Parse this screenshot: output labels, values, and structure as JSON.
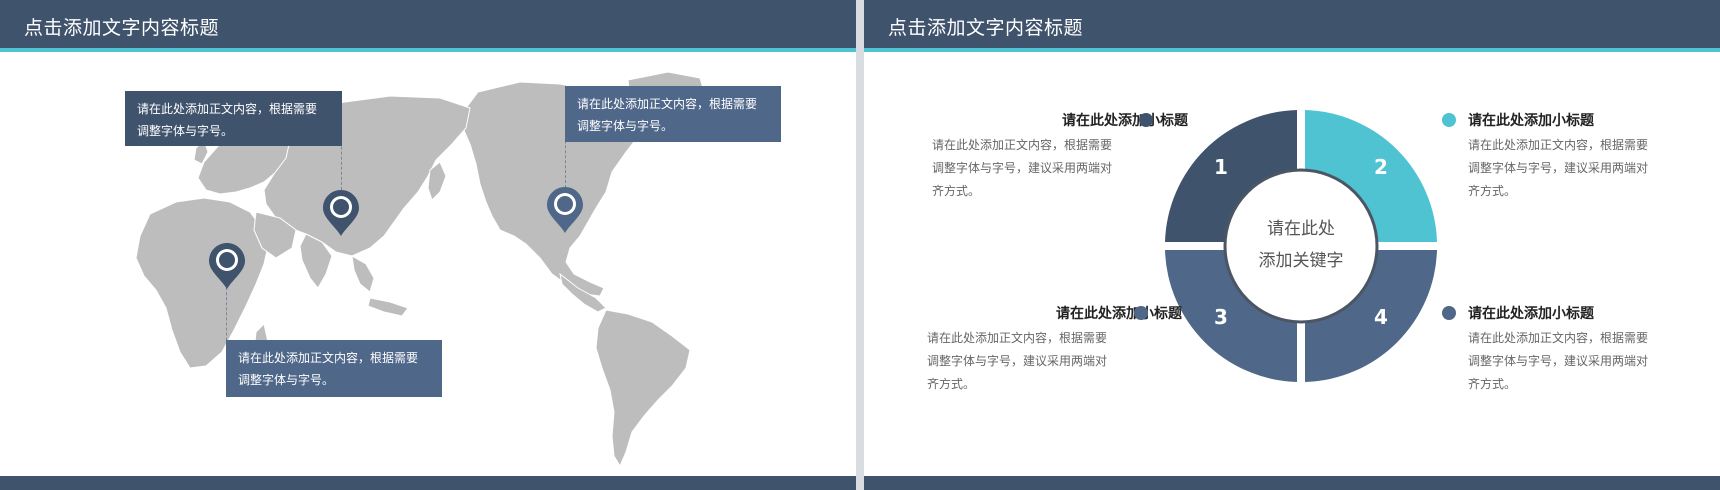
{
  "left_slide": {
    "title": "点击添加文字内容标题",
    "callouts": [
      {
        "text_line1": "请在此处添加正文内容，根据需要",
        "text_line2": "调整字体与字号。"
      },
      {
        "text_line1": "请在此处添加正文内容，根据需要",
        "text_line2": "调整字体与字号。"
      },
      {
        "text_line1": "请在此处添加正文内容，根据需要",
        "text_line2": "调整字体与字号。"
      }
    ],
    "map_pins": [
      "map-pin-icon",
      "map-pin-icon",
      "map-pin-icon"
    ]
  },
  "right_slide": {
    "title": "点击添加文字内容标题",
    "center_line1": "请在此处",
    "center_line2": "添加关键字",
    "segments": [
      "1",
      "2",
      "3",
      "4"
    ],
    "items": [
      {
        "title": "请在此处添加小标题",
        "body_line1": "请在此处添加正文内容，根据需要",
        "body_line2": "调整字体与字号，建议采用两端对",
        "body_line3": "齐方式。"
      },
      {
        "title": "请在此处添加小标题",
        "body_line1": "请在此处添加正文内容，根据需要",
        "body_line2": "调整字体与字号，建议采用两端对",
        "body_line3": "齐方式。"
      },
      {
        "title": "请在此处添加小标题",
        "body_line1": "请在此处添加正文内容，根据需要",
        "body_line2": "调整字体与字号，建议采用两端对",
        "body_line3": "齐方式。"
      },
      {
        "title": "请在此处添加小标题",
        "body_line1": "请在此处添加正文内容，根据需要",
        "body_line2": "调整字体与字号，建议采用两端对",
        "body_line3": "齐方式。"
      }
    ]
  },
  "colors": {
    "header": "#40536d",
    "accent": "#4fc3d1",
    "segment_dark": "#40536d",
    "segment_mid": "#4f6788",
    "map_gray": "#bdbdbd"
  }
}
